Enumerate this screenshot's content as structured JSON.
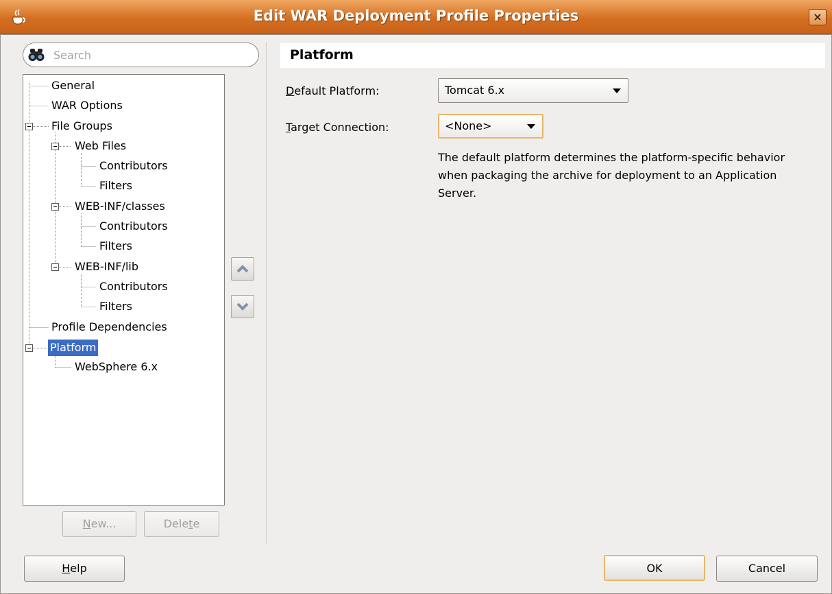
{
  "window": {
    "title": "Edit WAR Deployment Profile Properties",
    "close_label": "×"
  },
  "search": {
    "placeholder": "Search"
  },
  "tree": {
    "items": [
      {
        "label": "General"
      },
      {
        "label": "WAR Options"
      },
      {
        "label": "File Groups",
        "expanded": true
      },
      {
        "label": "Web Files",
        "expanded": true
      },
      {
        "label": "Contributors"
      },
      {
        "label": "Filters"
      },
      {
        "label": "WEB-INF/classes",
        "expanded": true
      },
      {
        "label": "Contributors"
      },
      {
        "label": "Filters"
      },
      {
        "label": "WEB-INF/lib",
        "expanded": true
      },
      {
        "label": "Contributors"
      },
      {
        "label": "Filters"
      },
      {
        "label": "Profile Dependencies"
      },
      {
        "label": "Platform",
        "expanded": true,
        "selected": true
      },
      {
        "label": "WebSphere 6.x"
      }
    ]
  },
  "tree_buttons": {
    "new_pre": "",
    "new_mn": "N",
    "new_post": "ew...",
    "delete_pre": "Dele",
    "delete_mn": "t",
    "delete_post": "e"
  },
  "panel": {
    "header": "Platform",
    "default_platform": {
      "label_mn": "D",
      "label_rest": "efault Platform:",
      "value": "Tomcat 6.x"
    },
    "target_connection": {
      "label_mn": "T",
      "label_rest": "arget Connection:",
      "value": "<None>"
    },
    "description": "The default platform determines the platform-specific behavior when packaging the archive for deployment to an Application Server."
  },
  "footer": {
    "help_mn": "H",
    "help_rest": "elp",
    "ok": "OK",
    "cancel": "Cancel"
  },
  "colors": {
    "titlebar": "#d46e20",
    "selection": "#3b6cc4",
    "focus_ring": "#e9b56a"
  }
}
